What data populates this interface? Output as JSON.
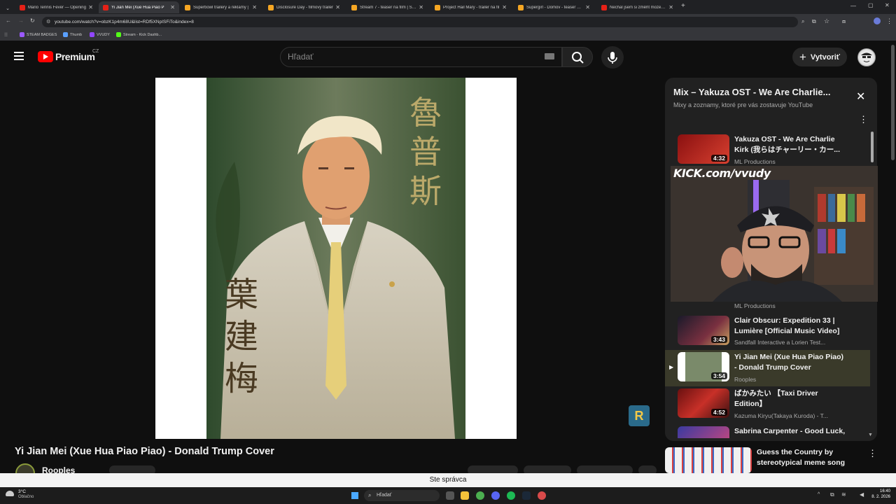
{
  "browser": {
    "tabs": [
      {
        "label": "Mario Tennis Fever — Opening",
        "color": "#e62117"
      },
      {
        "label": "Yi Jian Mei (Xue Hua Piao P",
        "color": "#e62117"
      },
      {
        "label": "Superbowl trailery a reklamy |",
        "color": "#f5a623"
      },
      {
        "label": "Disclosure Day - filmový trailer",
        "color": "#f5a623"
      },
      {
        "label": "Stream 7 - teaser na film | Sect",
        "color": "#f5a623"
      },
      {
        "label": "Project Hail Mary - trailer na fil",
        "color": "#f5a623"
      },
      {
        "label": "Supergirl - Domov - teaser na fi",
        "color": "#f5a623"
      },
      {
        "label": "Nechal jsem si změřit mozek na",
        "color": "#e62117"
      }
    ],
    "url": "youtube.com/watch?v=obzK1p4m68U&list=RDf5XNpISFiTo&index=8",
    "bookmarks": [
      {
        "label": "STEAM BADGES",
        "color": "#9b59ff"
      },
      {
        "label": "Thumb",
        "color": "#5aa0ff"
      },
      {
        "label": "VVUDY",
        "color": "#9146ff"
      },
      {
        "label": "Stream - Kick Dashb...",
        "color": "#53fc18"
      }
    ]
  },
  "header": {
    "logo_text": "Premium",
    "logo_region": "CZ",
    "search_placeholder": "Hľadať",
    "create_label": "Vytvoriť"
  },
  "video": {
    "title": "Yi Jian Mei (Xue Hua Piao Piao) - Donald Trump Cover",
    "channel": "Rooples",
    "cjk_right": [
      "魯",
      "普",
      "斯"
    ],
    "cjk_left": [
      "葉",
      "建",
      "梅"
    ]
  },
  "playlist": {
    "title": "Mix – Yakuza OST - We Are Charlie...",
    "subtitle": "Mixy a zoznamy, ktoré pre vás zostavuje YouTube",
    "items": [
      {
        "title": "Yakuza OST - We Are Charlie Kirk (我らはチャーリー・カー...",
        "channel": "ML Productions",
        "duration": "4:32"
      },
      {
        "title": "",
        "channel": "ML Productions",
        "duration": ""
      },
      {
        "title": "Clair Obscur: Expedition 33 | Lumière [Official Music Video]",
        "channel": "Sandfall Interactive a Lorien Test...",
        "duration": "3:43"
      },
      {
        "title": "Yi Jian Mei (Xue Hua Piao Piao) - Donald Trump Cover",
        "channel": "Rooples",
        "duration": "3:54"
      },
      {
        "title": "ばかみたい 【Taxi Driver Edition】",
        "channel": "Kazuma Kiryu(Takaya Kuroda) - T...",
        "duration": "4:52"
      },
      {
        "title": "Sabrina Carpenter - Good Luck,",
        "channel": "",
        "duration": ""
      }
    ]
  },
  "overlay": {
    "kick_text": "KICK.com/vvudy"
  },
  "recommended": {
    "title": "Guess the Country by stereotypical meme song"
  },
  "notice": {
    "text": "Ste správca"
  },
  "taskbar": {
    "weather_temp": "3°C",
    "weather_desc": "Oblačno",
    "search": "Hľadať",
    "time": "16:40",
    "date": "8. 2. 2026"
  }
}
